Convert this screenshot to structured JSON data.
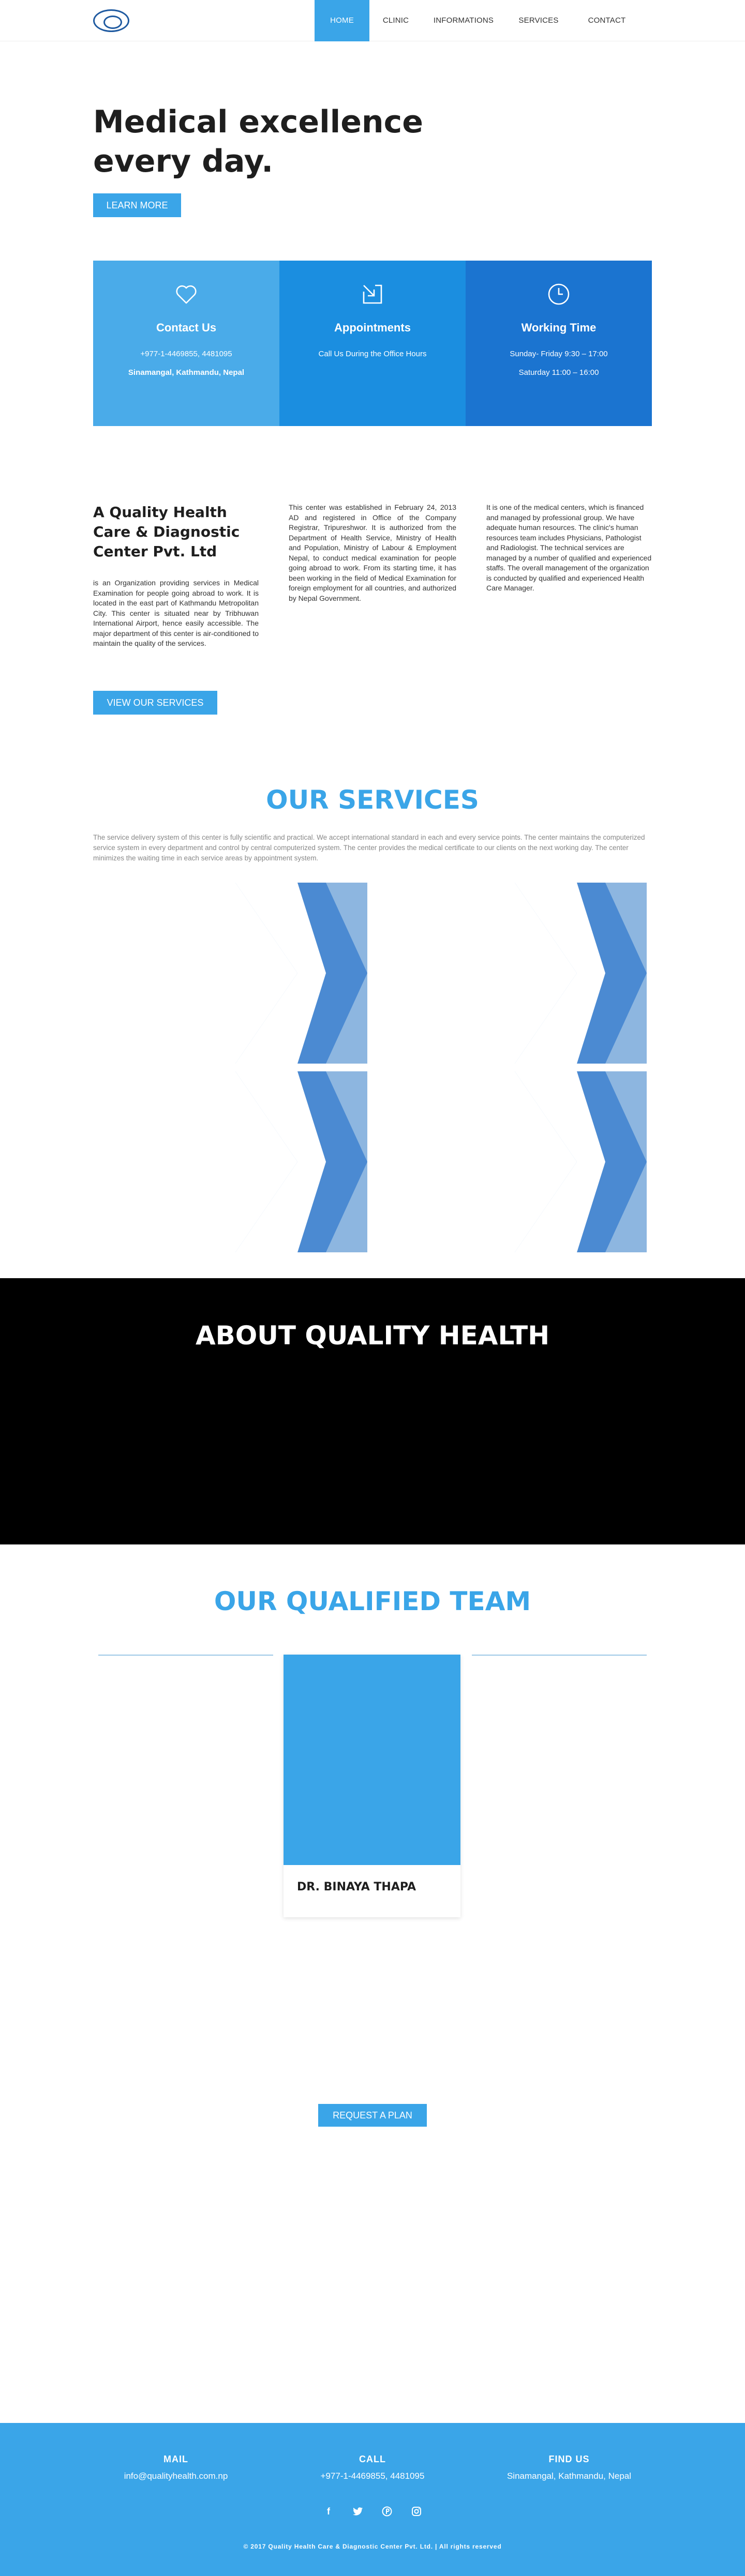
{
  "nav": {
    "items": [
      {
        "label": "HOME",
        "active": true
      },
      {
        "label": "CLINIC",
        "active": false
      },
      {
        "label": "INFORMATIONS",
        "active": false
      },
      {
        "label": "SERVICES",
        "active": false
      },
      {
        "label": "CONTACT",
        "active": false
      }
    ],
    "logo_icon": "clinic-logo"
  },
  "hero": {
    "title": "Medical excellence every day.",
    "button": "LEARN MORE"
  },
  "info_boxes": [
    {
      "icon": "heart-icon",
      "title": "Contact Us",
      "line1": "+977-1-4469855, 4481095",
      "line2": "Sinamangal, Kathmandu, Nepal",
      "color": "#4aabe9"
    },
    {
      "icon": "appointment-icon",
      "title": "Appointments",
      "line1": "Call Us During the Office Hours",
      "line2": "",
      "color": "#1b8ee0"
    },
    {
      "icon": "clock-icon",
      "title": "Working Time",
      "line1": "Sunday- Friday 9:30 – 17:00",
      "line2": "Saturday 11:00 – 16:00",
      "color": "#1b74d0"
    }
  ],
  "about": {
    "heading": "A Quality Health Care & Diagnostic Center Pvt. Ltd",
    "para1": "is an Organization providing services in Medical Examination for people going abroad to work. It is located in the east part of Kathmandu Metropolitan City. This center is situated near by Tribhuwan International Airport, hence easily accessible. The major department of this center is air-conditioned to maintain the quality of the services.",
    "para2": "This center was established in February 24, 2013 AD and registered in Office of the Company Registrar, Tripureshwor. It is authorized from the Department of Health Service, Ministry of Health and Population, Ministry of Labour & Employment Nepal, to conduct medical examination for people going abroad to work. From its starting time, it has been working in the field of Medical Examination for foreign employment for all countries, and authorized by Nepal Government.",
    "para3": "It is one of the medical centers, which is financed and managed by professional group. We have adequate human resources. The clinic's human resources team includes Physicians, Pathologist and Radiologist. The technical services are managed by a number of qualified and experienced staffs. The overall management of the organization is conducted by qualified and experienced Health Care Manager.",
    "button": "VIEW OUR SERVICES"
  },
  "services": {
    "title": "OUR SERVICES",
    "intro": "The service delivery system of this center is fully scientific and practical. We accept international standard in each and every service points.  The center maintains the computerized service system in every department and control by central computerized system. The center provides the medical certificate to our clients on the next working day. The center minimizes the waiting time in each service areas by appointment system."
  },
  "about_banner": {
    "title": "ABOUT QUALITY HEALTH"
  },
  "team": {
    "title": "OUR QUALIFIED TEAM",
    "members": [
      {
        "name": "DR. BINAYA THAPA"
      }
    ]
  },
  "request_plan": {
    "button": "REQUEST A PLAN"
  },
  "footer": {
    "columns": [
      {
        "heading": "MAIL",
        "value": "info@qualityhealth.com.np"
      },
      {
        "heading": "CALL",
        "value": "+977-1-4469855, 4481095"
      },
      {
        "heading": "FIND US",
        "value": "Sinamangal, Kathmandu, Nepal"
      }
    ],
    "socials": [
      "facebook-icon",
      "twitter-icon",
      "pinterest-icon",
      "instagram-icon"
    ],
    "copyright": "© 2017 Quality Health Care & Diagnostic Center Pvt. Ltd. | All rights reserved"
  },
  "colors": {
    "accent": "#3aa5e8",
    "service_dark": "#3f83cf",
    "service_light": "#8db6e0"
  }
}
